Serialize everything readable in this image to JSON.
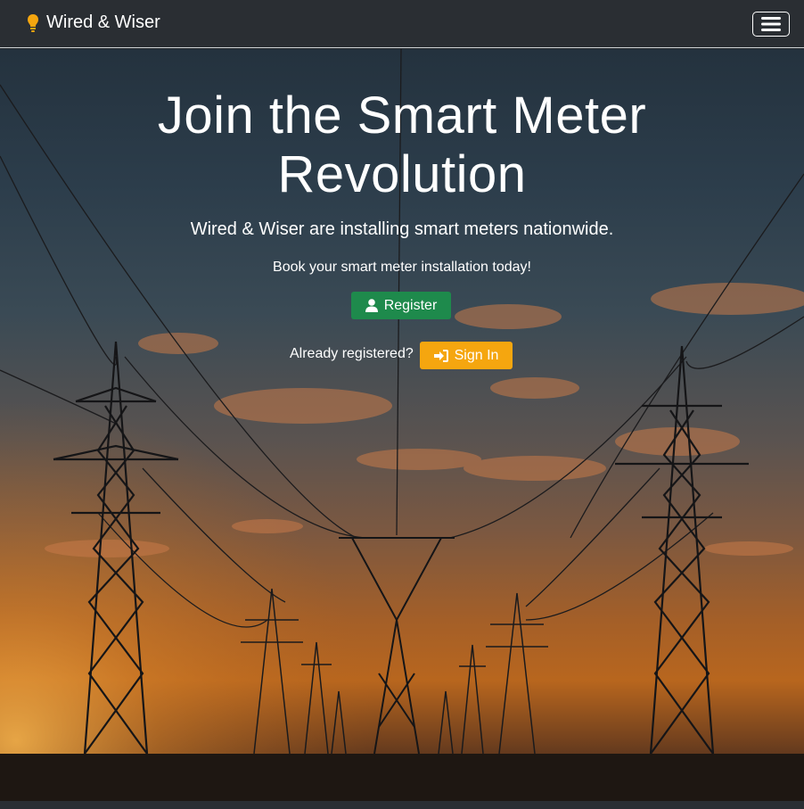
{
  "navbar": {
    "brand_icon": "lightbulb-icon",
    "brand_icon_color": "#f5a60f",
    "brand_name": "Wired & Wiser",
    "menu_icon": "hamburger-menu-icon"
  },
  "hero": {
    "background": "power-lines-sunset-image",
    "title_line1": "Join the Smart Meter",
    "title_line2": "Revolution",
    "subtitle": "Wired & Wiser are installing smart meters nationwide.",
    "cta_text": "Book your smart meter installation today!",
    "register": {
      "icon": "user-icon",
      "label": "Register",
      "color": "#1e8a4c"
    },
    "already_registered_text": "Already registered?",
    "signin": {
      "icon": "sign-in-icon",
      "label": "Sign In",
      "color": "#f5a60f"
    }
  }
}
